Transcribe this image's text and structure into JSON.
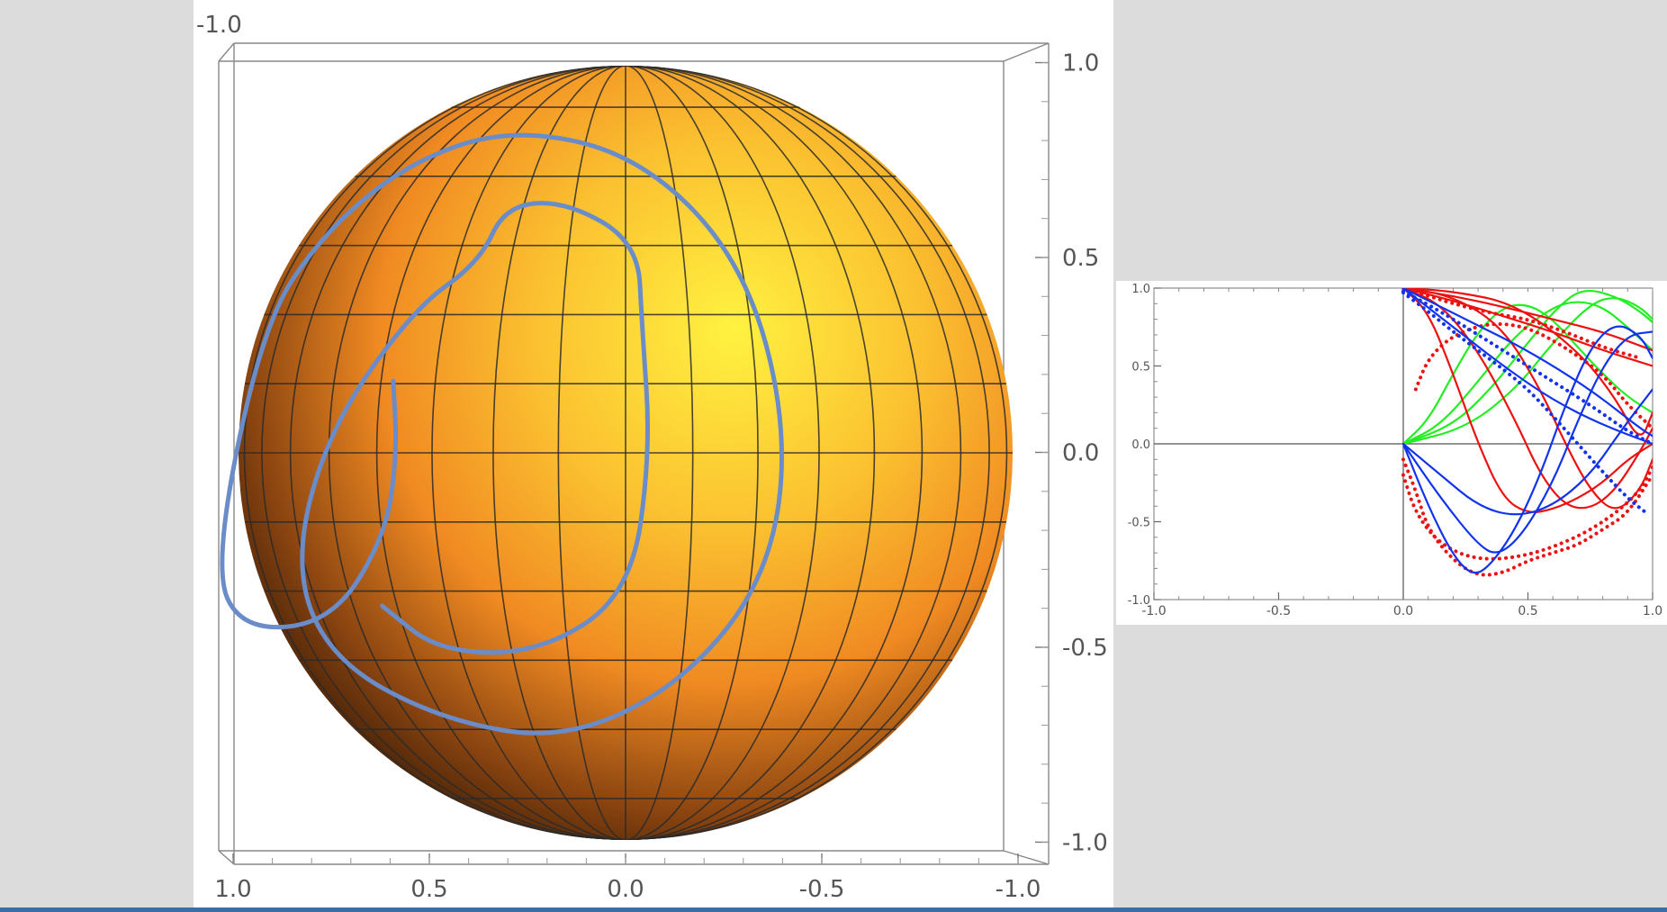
{
  "colors": {
    "background": "#dcdcdc",
    "panel": "#ffffff",
    "sphere_light": "#fff240",
    "sphere_mid": "#f7a030",
    "sphere_dark": "#3a1c06",
    "mesh": "#2a2a2a",
    "curve3d": "#6a8cc8",
    "green": "#22ee22",
    "red": "#ee1111",
    "blue": "#1133ee",
    "status_bar": "#3a6ea5"
  },
  "chart_data": [
    {
      "id": "sphere_plot",
      "type": "3d-surface",
      "surface": "unit sphere",
      "mesh": "latitude/longitude grid",
      "top_left_label": "-1.0",
      "x_axis": {
        "range": [
          1.0,
          -1.0
        ],
        "tick_labels": [
          "1.0",
          "0.5",
          "0.0",
          "-0.5",
          "-1.0"
        ],
        "tick_values": [
          1.0,
          0.5,
          0.0,
          -0.5,
          -1.0
        ]
      },
      "y_axis": {
        "range": [
          -1.0,
          1.0
        ],
        "tick_labels": [
          "1.0",
          "0.5",
          "0.0",
          "-0.5",
          "-1.0"
        ],
        "tick_values": [
          1.0,
          0.5,
          0.0,
          -0.5,
          -1.0
        ]
      },
      "spiral": {
        "points": [
          [
            0.592,
            0.183
          ],
          [
            0.582,
            0.0
          ],
          [
            0.612,
            -0.213
          ],
          [
            0.75,
            -0.433
          ],
          [
            0.977,
            -0.453
          ],
          [
            1.051,
            -0.291
          ],
          [
            0.926,
            0.322
          ],
          [
            0.775,
            0.555
          ],
          [
            0.552,
            0.742
          ],
          [
            0.28,
            0.83
          ],
          [
            -0.044,
            0.753
          ],
          [
            -0.304,
            0.48
          ],
          [
            -0.415,
            0.059
          ],
          [
            -0.366,
            -0.311
          ],
          [
            -0.147,
            -0.587
          ],
          [
            0.153,
            -0.733
          ],
          [
            0.468,
            -0.681
          ],
          [
            0.751,
            -0.528
          ],
          [
            0.847,
            -0.286
          ],
          [
            0.757,
            0.059
          ],
          [
            0.54,
            0.367
          ],
          [
            0.372,
            0.486
          ],
          [
            0.307,
            0.629
          ],
          [
            0.154,
            0.642
          ],
          [
            -0.031,
            0.536
          ],
          [
            -0.042,
            0.325
          ],
          [
            -0.064,
            0.0
          ],
          [
            -0.012,
            -0.36
          ],
          [
            0.219,
            -0.51
          ],
          [
            0.475,
            -0.507
          ],
          [
            0.62,
            -0.39
          ]
        ]
      }
    },
    {
      "id": "small_plot",
      "type": "line",
      "xlim": [
        -1.0,
        1.0
      ],
      "ylim": [
        -1.0,
        1.0
      ],
      "x_tick_labels": [
        "-1.0",
        "-0.5",
        "0.0",
        "0.5",
        "1.0"
      ],
      "x_tick_values": [
        -1.0,
        -0.5,
        0.0,
        0.5,
        1.0
      ],
      "y_tick_labels": [
        "1.0",
        "0.5",
        "0.0",
        "-0.5",
        "-1.0"
      ],
      "y_tick_values": [
        1.0,
        0.5,
        0.0,
        -0.5,
        -1.0
      ],
      "series": [
        {
          "color": "green",
          "style": "solid",
          "points": [
            [
              0,
              0
            ],
            [
              0.1,
              0.15
            ],
            [
              0.2,
              0.45
            ],
            [
              0.3,
              0.72
            ],
            [
              0.4,
              0.88
            ],
            [
              0.5,
              0.9
            ],
            [
              0.6,
              0.8
            ],
            [
              0.7,
              0.62
            ],
            [
              0.8,
              0.45
            ],
            [
              0.9,
              0.3
            ],
            [
              1.0,
              0.2
            ]
          ]
        },
        {
          "color": "green",
          "style": "solid",
          "points": [
            [
              0,
              0
            ],
            [
              0.15,
              0.12
            ],
            [
              0.3,
              0.4
            ],
            [
              0.45,
              0.7
            ],
            [
              0.6,
              0.88
            ],
            [
              0.7,
              0.92
            ],
            [
              0.8,
              0.88
            ],
            [
              0.9,
              0.75
            ],
            [
              1.0,
              0.6
            ]
          ]
        },
        {
          "color": "green",
          "style": "solid",
          "points": [
            [
              0,
              0
            ],
            [
              0.2,
              0.12
            ],
            [
              0.35,
              0.35
            ],
            [
              0.5,
              0.65
            ],
            [
              0.62,
              0.88
            ],
            [
              0.72,
              1.0
            ],
            [
              0.85,
              0.95
            ],
            [
              0.95,
              0.85
            ],
            [
              1.0,
              0.78
            ]
          ]
        },
        {
          "color": "green",
          "style": "solid",
          "points": [
            [
              0,
              0
            ],
            [
              0.25,
              0.1
            ],
            [
              0.45,
              0.35
            ],
            [
              0.6,
              0.65
            ],
            [
              0.75,
              0.9
            ],
            [
              0.85,
              0.95
            ],
            [
              0.95,
              0.88
            ],
            [
              1.0,
              0.8
            ]
          ]
        },
        {
          "color": "red",
          "style": "solid",
          "points": [
            [
              0,
              1.0
            ],
            [
              0.2,
              0.95
            ],
            [
              0.4,
              0.88
            ],
            [
              0.6,
              0.8
            ],
            [
              0.8,
              0.72
            ],
            [
              1.0,
              0.6
            ]
          ]
        },
        {
          "color": "red",
          "style": "solid",
          "points": [
            [
              0,
              1.0
            ],
            [
              0.2,
              0.92
            ],
            [
              0.4,
              0.82
            ],
            [
              0.6,
              0.72
            ],
            [
              0.8,
              0.6
            ],
            [
              1.0,
              0.5
            ]
          ]
        },
        {
          "color": "red",
          "style": "solid",
          "points": [
            [
              0,
              1.0
            ],
            [
              0.1,
              0.85
            ],
            [
              0.2,
              0.45
            ],
            [
              0.3,
              0.0
            ],
            [
              0.4,
              -0.35
            ],
            [
              0.5,
              -0.45
            ],
            [
              0.6,
              -0.42
            ],
            [
              0.7,
              -0.35
            ],
            [
              0.8,
              -0.25
            ],
            [
              0.9,
              -0.1
            ],
            [
              1.0,
              0.0
            ]
          ]
        },
        {
          "color": "red",
          "style": "solid",
          "points": [
            [
              0,
              1.0
            ],
            [
              0.15,
              0.9
            ],
            [
              0.3,
              0.6
            ],
            [
              0.45,
              0.15
            ],
            [
              0.55,
              -0.2
            ],
            [
              0.65,
              -0.4
            ],
            [
              0.75,
              -0.42
            ],
            [
              0.85,
              -0.3
            ],
            [
              0.95,
              -0.05
            ],
            [
              1.0,
              0.1
            ]
          ]
        },
        {
          "color": "red",
          "style": "solid",
          "points": [
            [
              0,
              1.0
            ],
            [
              0.2,
              0.95
            ],
            [
              0.4,
              0.75
            ],
            [
              0.55,
              0.35
            ],
            [
              0.65,
              0.0
            ],
            [
              0.75,
              -0.3
            ],
            [
              0.85,
              -0.45
            ],
            [
              0.95,
              -0.3
            ],
            [
              1.0,
              -0.1
            ]
          ]
        },
        {
          "color": "red",
          "style": "solid",
          "points": [
            [
              0,
              1.0
            ],
            [
              0.2,
              0.98
            ],
            [
              0.45,
              0.9
            ],
            [
              0.7,
              0.6
            ],
            [
              0.85,
              0.3
            ],
            [
              0.95,
              0.0
            ],
            [
              1.0,
              0.2
            ]
          ]
        },
        {
          "color": "red",
          "style": "dotted",
          "points": [
            [
              0,
              -0.1
            ],
            [
              0.05,
              -0.3
            ],
            [
              0.1,
              -0.55
            ],
            [
              0.2,
              -0.75
            ],
            [
              0.3,
              -0.85
            ],
            [
              0.4,
              -0.83
            ],
            [
              0.5,
              -0.75
            ],
            [
              0.6,
              -0.7
            ],
            [
              0.7,
              -0.65
            ],
            [
              0.8,
              -0.55
            ],
            [
              0.9,
              -0.45
            ],
            [
              1.0,
              -0.2
            ]
          ]
        },
        {
          "color": "red",
          "style": "dotted",
          "points": [
            [
              0,
              -0.2
            ],
            [
              0.05,
              -0.45
            ],
            [
              0.15,
              -0.65
            ],
            [
              0.3,
              -0.75
            ],
            [
              0.5,
              -0.72
            ],
            [
              0.7,
              -0.6
            ],
            [
              0.85,
              -0.45
            ],
            [
              0.95,
              -0.3
            ],
            [
              1.0,
              -0.15
            ]
          ]
        },
        {
          "color": "red",
          "style": "dotted",
          "points": [
            [
              0.05,
              0.35
            ],
            [
              0.1,
              0.55
            ],
            [
              0.2,
              0.7
            ],
            [
              0.35,
              0.78
            ],
            [
              0.5,
              0.75
            ],
            [
              0.65,
              0.62
            ],
            [
              0.8,
              0.45
            ],
            [
              0.9,
              0.25
            ],
            [
              1.0,
              0.1
            ]
          ]
        },
        {
          "color": "red",
          "style": "dotted",
          "points": [
            [
              0,
              1.0
            ],
            [
              0.1,
              0.95
            ],
            [
              0.2,
              0.9
            ],
            [
              0.35,
              0.84
            ],
            [
              0.5,
              0.8
            ],
            [
              0.65,
              0.72
            ],
            [
              0.8,
              0.62
            ],
            [
              0.95,
              0.55
            ]
          ]
        },
        {
          "color": "blue",
          "style": "solid",
          "points": [
            [
              0,
              0
            ],
            [
              0.1,
              -0.4
            ],
            [
              0.2,
              -0.72
            ],
            [
              0.28,
              -0.85
            ],
            [
              0.35,
              -0.78
            ],
            [
              0.45,
              -0.55
            ],
            [
              0.55,
              -0.2
            ],
            [
              0.65,
              0.25
            ],
            [
              0.75,
              0.62
            ],
            [
              0.85,
              0.78
            ],
            [
              0.95,
              0.7
            ],
            [
              1.0,
              0.55
            ]
          ]
        },
        {
          "color": "blue",
          "style": "solid",
          "points": [
            [
              0,
              0
            ],
            [
              0.15,
              -0.35
            ],
            [
              0.3,
              -0.65
            ],
            [
              0.38,
              -0.72
            ],
            [
              0.48,
              -0.58
            ],
            [
              0.6,
              -0.25
            ],
            [
              0.7,
              0.15
            ],
            [
              0.8,
              0.5
            ],
            [
              0.9,
              0.7
            ],
            [
              1.0,
              0.72
            ]
          ]
        },
        {
          "color": "blue",
          "style": "solid",
          "points": [
            [
              0,
              0
            ],
            [
              0.15,
              -0.2
            ],
            [
              0.3,
              -0.4
            ],
            [
              0.45,
              -0.47
            ],
            [
              0.6,
              -0.4
            ],
            [
              0.75,
              -0.2
            ],
            [
              0.88,
              0.1
            ],
            [
              1.0,
              0.35
            ]
          ]
        },
        {
          "color": "blue",
          "style": "solid",
          "points": [
            [
              0,
              1.0
            ],
            [
              0.2,
              0.75
            ],
            [
              0.4,
              0.5
            ],
            [
              0.6,
              0.28
            ],
            [
              0.8,
              0.12
            ],
            [
              1.0,
              0.0
            ]
          ]
        },
        {
          "color": "blue",
          "style": "solid",
          "points": [
            [
              0,
              1.0
            ],
            [
              0.25,
              0.8
            ],
            [
              0.5,
              0.6
            ],
            [
              0.75,
              0.35
            ],
            [
              0.95,
              0.1
            ],
            [
              1.0,
              0.05
            ]
          ]
        },
        {
          "color": "blue",
          "style": "dotted",
          "points": [
            [
              0,
              0.97
            ],
            [
              0.1,
              0.85
            ],
            [
              0.2,
              0.72
            ],
            [
              0.3,
              0.6
            ],
            [
              0.4,
              0.48
            ],
            [
              0.5,
              0.35
            ],
            [
              0.6,
              0.18
            ],
            [
              0.7,
              0.0
            ],
            [
              0.8,
              -0.18
            ],
            [
              0.9,
              -0.35
            ],
            [
              0.98,
              -0.45
            ]
          ]
        },
        {
          "color": "blue",
          "style": "dotted",
          "points": [
            [
              0,
              0.98
            ],
            [
              0.15,
              0.85
            ],
            [
              0.35,
              0.65
            ],
            [
              0.55,
              0.45
            ],
            [
              0.75,
              0.25
            ],
            [
              0.9,
              0.08
            ],
            [
              1.0,
              0.0
            ]
          ]
        }
      ]
    }
  ]
}
